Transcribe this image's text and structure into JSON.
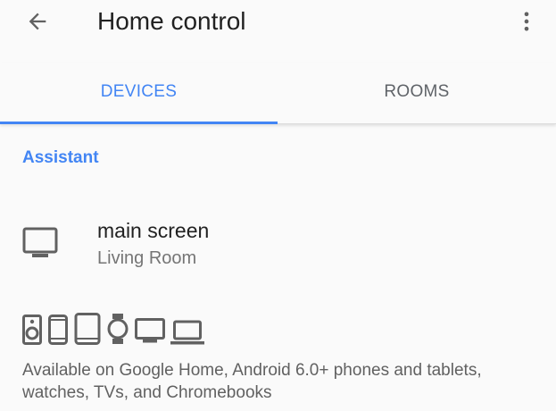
{
  "header": {
    "title": "Home control",
    "back_icon": "arrow-back-icon",
    "menu_icon": "more-vert-icon"
  },
  "tabs": [
    {
      "label": "DEVICES",
      "selected": true
    },
    {
      "label": "ROOMS",
      "selected": false
    }
  ],
  "section": {
    "title": "Assistant"
  },
  "devices": [
    {
      "name": "main screen",
      "room": "Living Room",
      "icon": "tv-icon"
    }
  ],
  "supported_device_icons": [
    "speaker-icon",
    "phone-icon",
    "tablet-icon",
    "watch-icon",
    "tv-icon",
    "laptop-icon"
  ],
  "footnote": "Available on Google Home, Android 6.0+ phones and tablets, watches, TVs, and Chromebooks",
  "colors": {
    "accent": "#4285f4",
    "icon_gray": "#616161",
    "background": "#fafafa"
  }
}
